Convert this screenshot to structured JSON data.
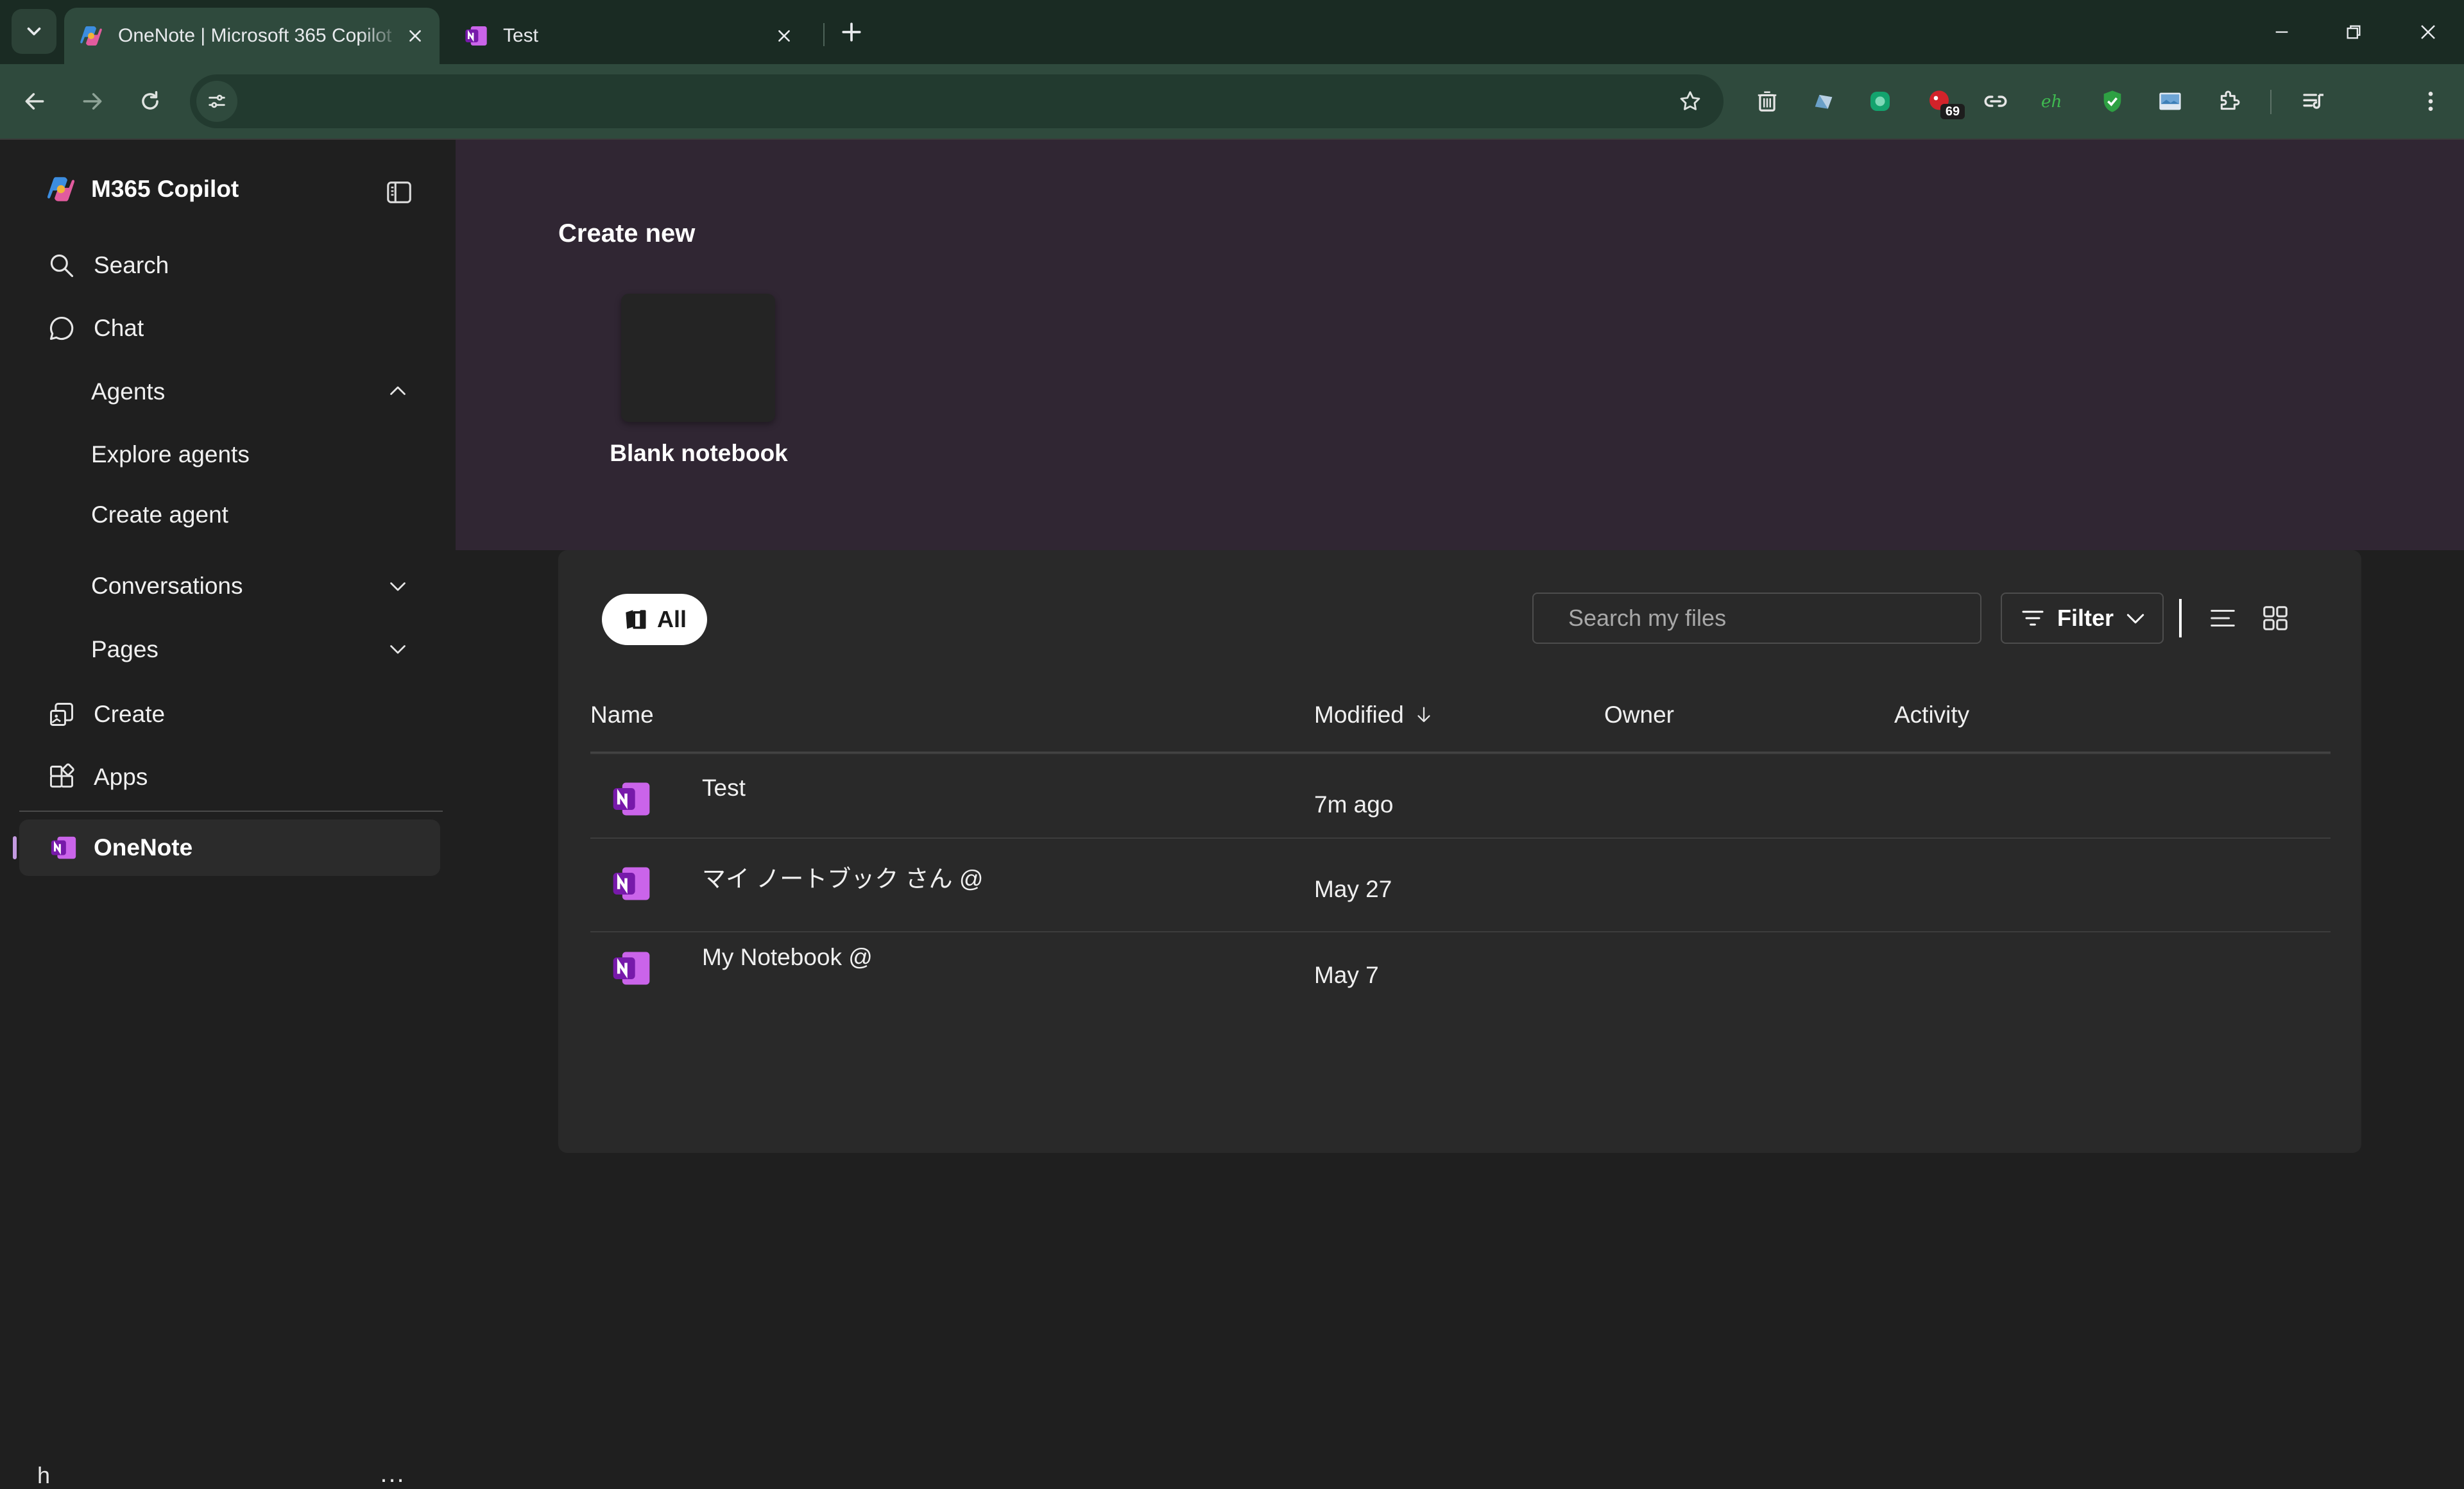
{
  "browser": {
    "tabs": [
      {
        "title": "OneNote | Microsoft 365 Copilot",
        "active": true
      },
      {
        "title": "Test",
        "active": false
      }
    ],
    "extension_badge": "69"
  },
  "sidebar": {
    "app_name": "M365 Copilot",
    "items": {
      "search": "Search",
      "chat": "Chat",
      "agents": "Agents",
      "explore_agents": "Explore agents",
      "create_agent": "Create agent",
      "conversations": "Conversations",
      "pages": "Pages",
      "create": "Create",
      "apps": "Apps",
      "onenote": "OneNote"
    },
    "user_initial": "h",
    "more_label": "..."
  },
  "main": {
    "create_title": "Create new",
    "blank_notebook_label": "Blank notebook",
    "filter_all_label": "All",
    "search_placeholder": "Search my files",
    "filter_label": "Filter",
    "columns": {
      "name": "Name",
      "modified": "Modified",
      "owner": "Owner",
      "activity": "Activity"
    },
    "rows": [
      {
        "name": "Test",
        "modified": "7m ago"
      },
      {
        "name": "マイ ノートブック さん @",
        "modified": "May 27"
      },
      {
        "name": "My Notebook @",
        "modified": "May 7"
      }
    ]
  },
  "colors": {
    "tab_strip": "#1a2b23",
    "toolbar": "#2f4a3d",
    "hero": "#302633",
    "panel": "#292929",
    "onenote_purple": "#7719aa"
  }
}
